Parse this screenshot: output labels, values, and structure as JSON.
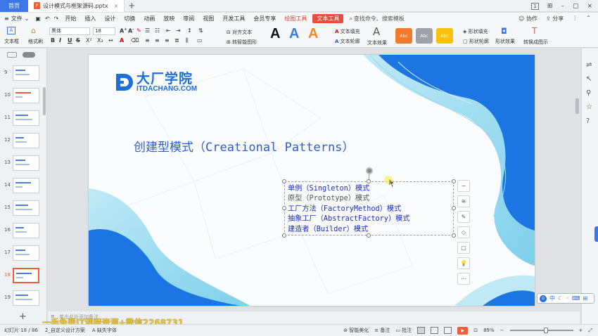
{
  "titlebar": {
    "home_tab": "首页",
    "doc_tab": "设计模式与框架源码.pptx",
    "doc_icon": "P",
    "add_tab": "+",
    "badge": "1",
    "close": "×"
  },
  "menu": {
    "file": "文件",
    "items": [
      "开始",
      "插入",
      "设计",
      "切换",
      "动画",
      "放映",
      "审阅",
      "视图",
      "开发工具",
      "会员专享"
    ],
    "drawing_tools": "绘图工具",
    "text_tools": "文本工具",
    "search": "查找命令、搜索模板",
    "collab": "协作",
    "share": "分享"
  },
  "ribbon": {
    "text_box": "文本框",
    "format_painter": "格式刷",
    "font_name": "黑体",
    "font_size": "18",
    "bold": "B",
    "italic": "I",
    "underline": "U",
    "strike": "S",
    "convert_text": "对齐文本",
    "smart_shape": "转智能图形",
    "text_fill": "文本填充",
    "text_outline": "文本轮廓",
    "text_effect": "文本效果",
    "shape_fill": "形状填充",
    "shape_outline": "形状轮廓",
    "shape_effect": "形状效果",
    "convert_graphic": "转换成图示",
    "art_letters": [
      "A",
      "A",
      "A"
    ],
    "style_label": "Abc"
  },
  "slides_panel": {
    "numbers": [
      "9",
      "10",
      "11",
      "12",
      "13",
      "14",
      "15",
      "16",
      "17",
      "18",
      "19"
    ],
    "selected": "18",
    "add": "+"
  },
  "slide": {
    "logo_cn": "大厂学院",
    "logo_en": "ITDACHANG.COM",
    "title": "创建型模式（Creational Patterns）",
    "lines": [
      "单例（Singleton）模式",
      "原型（Prototype）模式",
      "工厂方法（FactoryMethod）模式",
      "抽象工厂（AbstractFactory）模式",
      "建造者（Builder）模式"
    ],
    "line_colors": [
      "#1a2fc0",
      "#555555",
      "#1a2fc0",
      "#1a2fc0",
      "#1a2fc0"
    ],
    "colors": {
      "blue": "#1976e6",
      "light_blue": "#8fd6ee",
      "title": "#2b5fd0"
    }
  },
  "float_tools": [
    "−",
    "≋",
    "✎",
    "◇",
    "▢",
    "💡",
    "⋯"
  ],
  "ime": {
    "label": "中"
  },
  "notes": {
    "hint": "单击此处添加备注"
  },
  "watermark": "一手免费IT课程资源+微信2268731",
  "status": {
    "slide_of": "幻灯片 18 / 86",
    "theme": "2_自定义设计方案",
    "missing_font": "缺失字体",
    "smart_beautify": "智能美化",
    "notes": "备注",
    "comments": "批注",
    "zoom": "89%",
    "zoom_minus": "−",
    "zoom_plus": "+"
  }
}
